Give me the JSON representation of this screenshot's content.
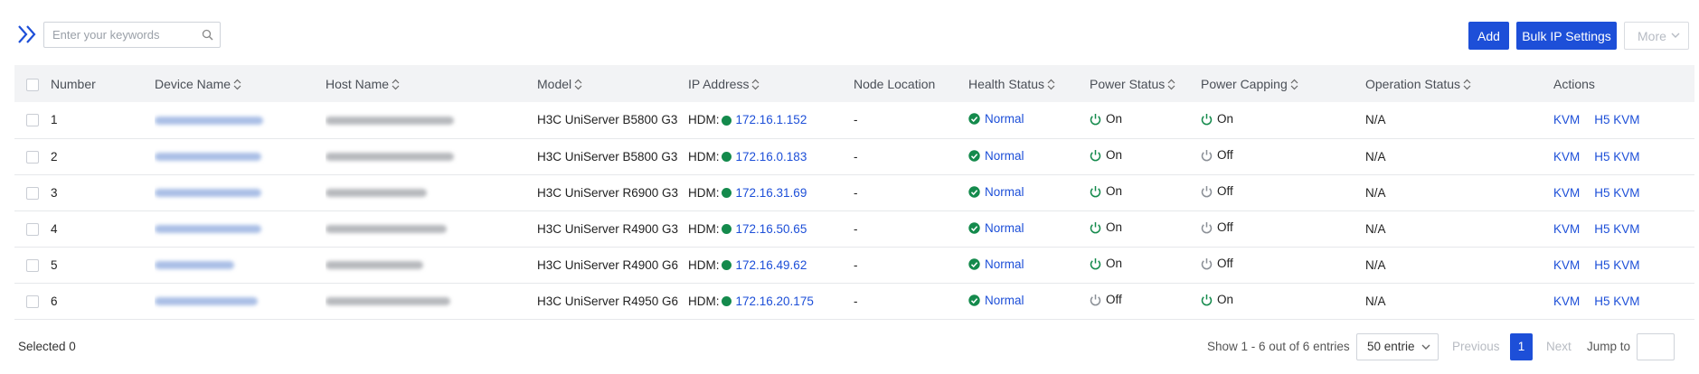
{
  "toolbar": {
    "search_placeholder": "Enter your keywords",
    "add_label": "Add",
    "bulk_ip_label": "Bulk IP Settings",
    "more_label": "More"
  },
  "table": {
    "columns": [
      "Number",
      "Device Name",
      "Host Name",
      "Model",
      "IP Address",
      "Node Location",
      "Health Status",
      "Power Status",
      "Power Capping",
      "Operation Status",
      "Actions"
    ],
    "rows": [
      {
        "number": "1",
        "model": "H3C UniServer B5800 G3",
        "ip_prefix": "HDM:",
        "ip": "172.16.1.152",
        "location": "-",
        "health": "Normal",
        "power": "On",
        "capping": "On",
        "operation": "N/A",
        "kvm": "KVM",
        "h5kvm": "H5 KVM"
      },
      {
        "number": "2",
        "model": "H3C UniServer B5800 G3",
        "ip_prefix": "HDM:",
        "ip": "172.16.0.183",
        "location": "-",
        "health": "Normal",
        "power": "On",
        "capping": "Off",
        "operation": "N/A",
        "kvm": "KVM",
        "h5kvm": "H5 KVM"
      },
      {
        "number": "3",
        "model": "H3C UniServer R6900 G3",
        "ip_prefix": "HDM:",
        "ip": "172.16.31.69",
        "location": "-",
        "health": "Normal",
        "power": "On",
        "capping": "Off",
        "operation": "N/A",
        "kvm": "KVM",
        "h5kvm": "H5 KVM"
      },
      {
        "number": "4",
        "model": "H3C UniServer R4900 G3",
        "ip_prefix": "HDM:",
        "ip": "172.16.50.65",
        "location": "-",
        "health": "Normal",
        "power": "On",
        "capping": "Off",
        "operation": "N/A",
        "kvm": "KVM",
        "h5kvm": "H5 KVM"
      },
      {
        "number": "5",
        "model": "H3C UniServer R4900 G6",
        "ip_prefix": "HDM:",
        "ip": "172.16.49.62",
        "location": "-",
        "health": "Normal",
        "power": "On",
        "capping": "Off",
        "operation": "N/A",
        "kvm": "KVM",
        "h5kvm": "H5 KVM"
      },
      {
        "number": "6",
        "model": "H3C UniServer R4950 G6",
        "ip_prefix": "HDM:",
        "ip": "172.16.20.175",
        "location": "-",
        "health": "Normal",
        "power": "Off",
        "capping": "On",
        "operation": "N/A",
        "kvm": "KVM",
        "h5kvm": "H5 KVM"
      }
    ]
  },
  "footer": {
    "selected": "Selected 0",
    "entries": "Show 1 - 6 out of 6 entries",
    "page_size": "50 entrie",
    "prev": "Previous",
    "current_page": "1",
    "next": "Next",
    "jump_to": "Jump to"
  },
  "colors": {
    "primary": "#1d4fd8",
    "status_green": "#148a4c",
    "power_off_gray": "#8a8f96",
    "header_bg": "#f2f3f5"
  },
  "icons": {
    "expand": "double-chevron-right-icon",
    "search": "search-icon",
    "health_ok": "check-circle-icon",
    "power": "power-icon",
    "sort": "sort-arrows-icon",
    "dropdown": "chevron-down-icon"
  }
}
